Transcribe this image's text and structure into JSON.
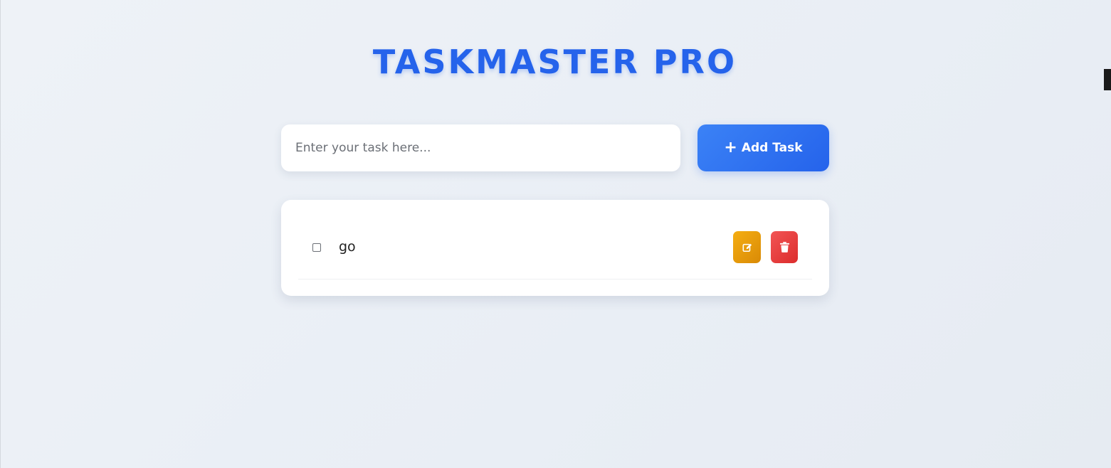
{
  "header": {
    "title": "TASKMASTER PRO"
  },
  "task_form": {
    "input_value": "",
    "input_placeholder": "Enter your task here...",
    "add_button_icon": "plus-icon",
    "add_button_label": "Add Task"
  },
  "tasks": [
    {
      "text": "go",
      "completed": false,
      "edit_icon": "edit-icon",
      "delete_icon": "trash-icon"
    }
  ],
  "colors": {
    "accent": "#2563eb",
    "edit": "#f59e0b",
    "delete": "#ef4444"
  }
}
